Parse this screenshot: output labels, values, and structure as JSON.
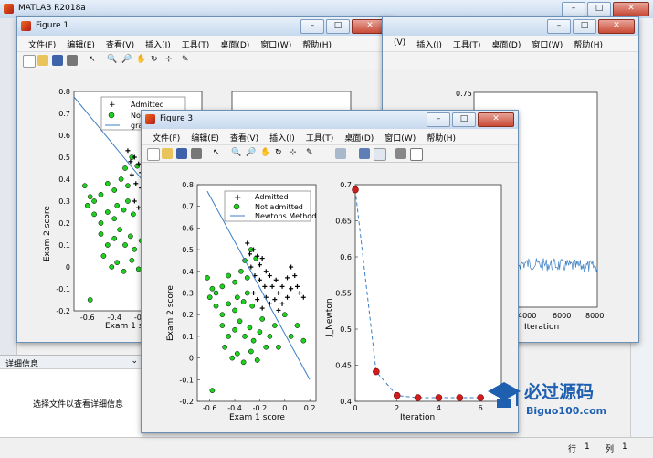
{
  "main_window": {
    "title": "MATLAB R2018a",
    "details_header": "详细信息",
    "details_text": "选择文件以查看详细信息",
    "status_row_label": "行",
    "status_row_value": "1",
    "status_col_label": "列",
    "status_col_value": "1"
  },
  "figure1": {
    "title": "Figure 1",
    "menu": [
      "文件(F)",
      "编辑(E)",
      "查看(V)",
      "插入(I)",
      "工具(T)",
      "桌面(D)",
      "窗口(W)",
      "帮助(H)"
    ],
    "visible_tail_menu": [
      "(V)",
      "插入(I)",
      "工具(T)",
      "桌面(D)",
      "窗口(W)",
      "帮助(H)"
    ],
    "yticks_left": [
      "0.8",
      "0.7",
      "0.6",
      "0.5",
      "0.4",
      "0.3",
      "0.2",
      "0.1",
      "0",
      "-0.1",
      "-0.2"
    ],
    "xticks_left": [
      "-0.6",
      "-0.4",
      "-0.2"
    ],
    "ylabel_left": "Exam 2 score",
    "xlabel_left_partial": "Exam 1 sc",
    "legend": [
      "Admitted",
      "Not",
      "gra"
    ],
    "right_plot": {
      "ytick_top": "0.75",
      "xticks": [
        "4000",
        "6000",
        "8000"
      ],
      "xlabel": "Iteration"
    }
  },
  "figure3": {
    "title": "Figure 3",
    "menu": [
      "文件(F)",
      "编辑(E)",
      "查看(V)",
      "插入(I)",
      "工具(T)",
      "桌面(D)",
      "窗口(W)",
      "帮助(H)"
    ]
  },
  "chart_data": [
    {
      "type": "scatter",
      "xlabel": "Exam 1 score",
      "ylabel": "Exam 2 score",
      "xlim": [
        -0.7,
        0.25
      ],
      "ylim": [
        -0.2,
        0.8
      ],
      "xticks": [
        "-0.6",
        "-0.4",
        "-0.2",
        "0",
        "0.2"
      ],
      "yticks": [
        "0.8",
        "0.7",
        "0.6",
        "0.5",
        "0.4",
        "0.3",
        "0.2",
        "0.1",
        "0",
        "-0.1",
        "-0.2"
      ],
      "legend": [
        "Admitted",
        "Not admitted",
        "Newtons Method"
      ],
      "admitted": [
        [
          -0.3,
          0.53
        ],
        [
          -0.28,
          0.48
        ],
        [
          -0.25,
          0.5
        ],
        [
          -0.22,
          0.47
        ],
        [
          -0.2,
          0.43
        ],
        [
          -0.18,
          0.46
        ],
        [
          -0.15,
          0.4
        ],
        [
          -0.27,
          0.42
        ],
        [
          -0.24,
          0.38
        ],
        [
          -0.2,
          0.36
        ],
        [
          -0.16,
          0.33
        ],
        [
          -0.12,
          0.38
        ],
        [
          -0.1,
          0.33
        ],
        [
          -0.07,
          0.36
        ],
        [
          -0.05,
          0.3
        ],
        [
          -0.02,
          0.33
        ],
        [
          -0.15,
          0.28
        ],
        [
          -0.12,
          0.25
        ],
        [
          -0.08,
          0.27
        ],
        [
          -0.05,
          0.22
        ],
        [
          -0.02,
          0.25
        ],
        [
          0.02,
          0.37
        ],
        [
          0.05,
          0.42
        ],
        [
          0.08,
          0.38
        ],
        [
          0.1,
          0.33
        ],
        [
          0.12,
          0.3
        ],
        [
          0.15,
          0.28
        ],
        [
          -0.22,
          0.27
        ],
        [
          -0.18,
          0.23
        ],
        [
          0.05,
          0.32
        ],
        [
          0.02,
          0.28
        ],
        [
          -0.25,
          0.3
        ]
      ],
      "not_admitted": [
        [
          -0.62,
          0.37
        ],
        [
          -0.58,
          0.32
        ],
        [
          -0.55,
          0.3
        ],
        [
          -0.5,
          0.33
        ],
        [
          -0.45,
          0.38
        ],
        [
          -0.4,
          0.35
        ],
        [
          -0.35,
          0.4
        ],
        [
          -0.32,
          0.45
        ],
        [
          -0.3,
          0.37
        ],
        [
          -0.27,
          0.5
        ],
        [
          -0.23,
          0.46
        ],
        [
          -0.55,
          0.24
        ],
        [
          -0.5,
          0.2
        ],
        [
          -0.45,
          0.25
        ],
        [
          -0.4,
          0.22
        ],
        [
          -0.38,
          0.28
        ],
        [
          -0.33,
          0.26
        ],
        [
          -0.3,
          0.3
        ],
        [
          -0.26,
          0.24
        ],
        [
          -0.5,
          0.15
        ],
        [
          -0.45,
          0.1
        ],
        [
          -0.4,
          0.13
        ],
        [
          -0.36,
          0.17
        ],
        [
          -0.32,
          0.1
        ],
        [
          -0.28,
          0.14
        ],
        [
          -0.25,
          0.08
        ],
        [
          -0.2,
          0.12
        ],
        [
          -0.18,
          0.18
        ],
        [
          -0.15,
          0.05
        ],
        [
          -0.12,
          0.1
        ],
        [
          -0.48,
          0.05
        ],
        [
          -0.42,
          0.0
        ],
        [
          -0.38,
          0.02
        ],
        [
          -0.33,
          -0.02
        ],
        [
          -0.27,
          0.03
        ],
        [
          -0.22,
          -0.01
        ],
        [
          -0.58,
          -0.15
        ],
        [
          -0.6,
          0.28
        ],
        [
          -0.08,
          0.15
        ],
        [
          0.0,
          0.2
        ],
        [
          0.05,
          0.1
        ],
        [
          0.1,
          0.15
        ],
        [
          0.15,
          0.08
        ],
        [
          -0.05,
          0.05
        ]
      ],
      "line": [
        [
          -0.62,
          0.77
        ],
        [
          0.2,
          -0.1
        ]
      ]
    },
    {
      "type": "line",
      "xlabel": "Iteration",
      "ylabel": "J_Newton",
      "xlim": [
        0,
        7
      ],
      "ylim": [
        0.4,
        0.7
      ],
      "xticks": [
        "0",
        "2",
        "4",
        "6"
      ],
      "yticks": [
        "0.7",
        "0.65",
        "0.6",
        "0.55",
        "0.5",
        "0.45",
        "0.4"
      ],
      "x": [
        0,
        1,
        2,
        3,
        4,
        5,
        6
      ],
      "y": [
        0.693,
        0.441,
        0.408,
        0.405,
        0.405,
        0.405,
        0.405
      ]
    }
  ]
}
